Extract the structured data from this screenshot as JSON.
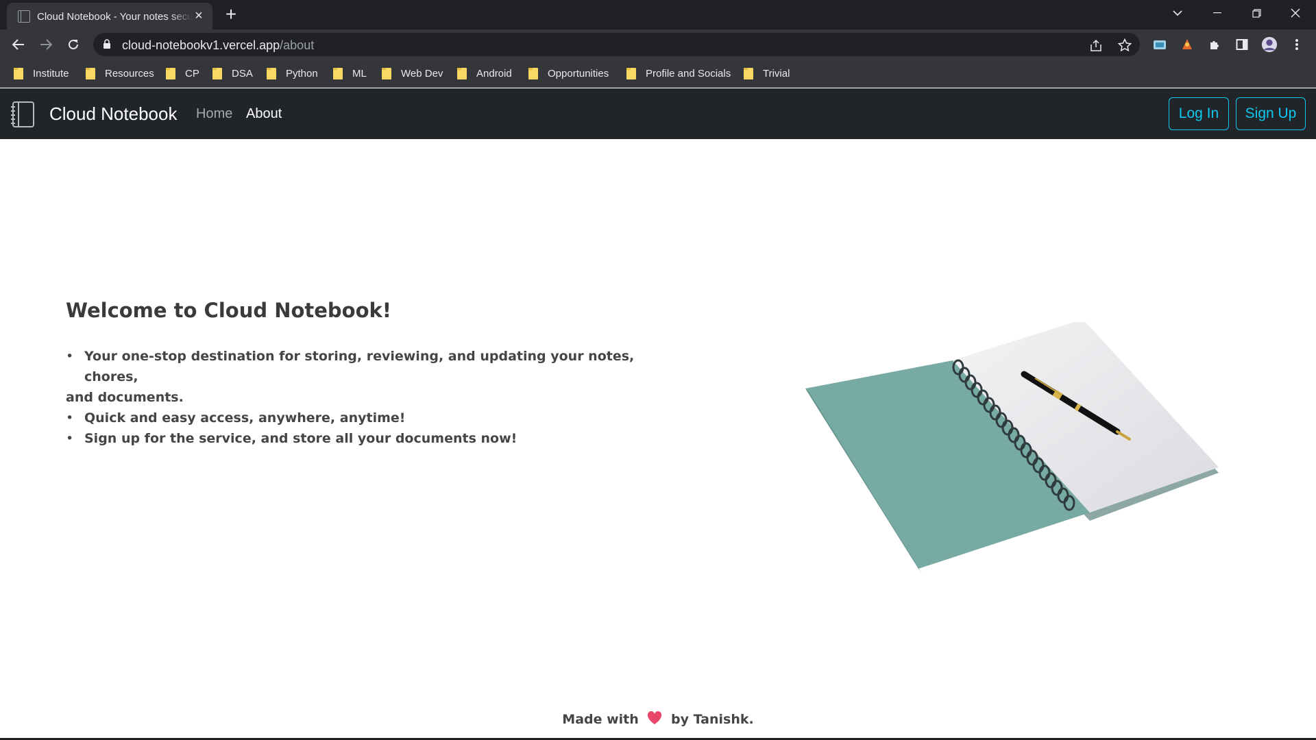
{
  "browser": {
    "tab_title": "Cloud Notebook - Your notes securely on the cloud",
    "url_host": "cloud-notebookv1.vercel.app",
    "url_path": "/about",
    "bookmarks": [
      "Institute",
      "Resources",
      "CP",
      "DSA",
      "Python",
      "ML",
      "Web Dev",
      "Android",
      "Opportunities",
      "Profile and Socials",
      "Trivial"
    ],
    "icons": {
      "back": "back-arrow-icon",
      "forward": "forward-arrow-icon",
      "reload": "reload-icon",
      "lock": "lock-icon",
      "share": "share-icon",
      "star": "star-icon",
      "extensions": "puzzle-icon",
      "side_panel": "side-panel-icon",
      "menu": "kebab-menu-icon"
    }
  },
  "navbar": {
    "brand": "Cloud Notebook",
    "links": {
      "home": "Home",
      "about": "About"
    },
    "login_label": "Log In",
    "signup_label": "Sign Up",
    "accent_color": "#0dcaf0",
    "background": "#212529"
  },
  "about": {
    "title": "Welcome to Cloud Notebook!",
    "points": [
      "Your one-stop destination for storing, reviewing, and updating your notes, chores,",
      "and documents.",
      "Quick and easy access, anywhere, anytime!",
      "Sign up for the service, and store all your documents now!"
    ]
  },
  "footer": {
    "prefix": "Made with",
    "suffix": "by Tanishk.",
    "heart_icon": "heart-icon"
  }
}
